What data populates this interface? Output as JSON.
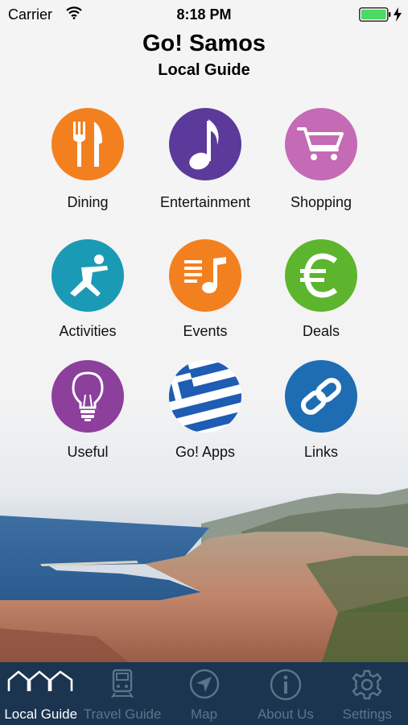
{
  "status_bar": {
    "carrier": "Carrier",
    "time": "8:18 PM"
  },
  "header": {
    "title": "Go! Samos",
    "subtitle": "Local Guide"
  },
  "tiles": [
    {
      "label": "Dining",
      "icon": "fork-knife-icon",
      "color": "#f3801f"
    },
    {
      "label": "Entertainment",
      "icon": "music-note-icon",
      "color": "#5b3a9c"
    },
    {
      "label": "Shopping",
      "icon": "shopping-cart-icon",
      "color": "#c56ab5"
    },
    {
      "label": "Activities",
      "icon": "stretching-person-icon",
      "color": "#1a9ab5"
    },
    {
      "label": "Events",
      "icon": "event-music-list-icon",
      "color": "#f3801f"
    },
    {
      "label": "Deals",
      "icon": "euro-icon",
      "color": "#5db52e"
    },
    {
      "label": "Useful",
      "icon": "lightbulb-icon",
      "color": "#8d3f9c"
    },
    {
      "label": "Go! Apps",
      "icon": "greek-flag-icon",
      "color": "#1f5cb3"
    },
    {
      "label": "Links",
      "icon": "chain-link-icon",
      "color": "#1e6db3"
    }
  ],
  "tab_bar": {
    "active": "Local Guide",
    "tabs": [
      {
        "label": "Local Guide",
        "icon": "houses-icon"
      },
      {
        "label": "Travel Guide",
        "icon": "train-icon"
      },
      {
        "label": "Map",
        "icon": "navigation-arrow-icon"
      },
      {
        "label": "About Us",
        "icon": "info-icon"
      },
      {
        "label": "Settings",
        "icon": "gear-icon"
      }
    ]
  },
  "colors": {
    "tab_bar_bg": "#1b3550",
    "tab_active": "#ffffff",
    "tab_inactive": "#5d7389",
    "battery": "#4cd964"
  }
}
